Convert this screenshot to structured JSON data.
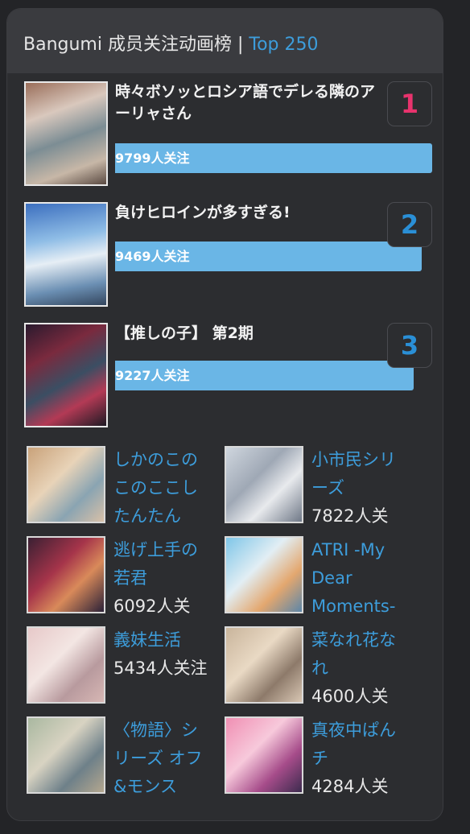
{
  "header": {
    "title": "Bangumi 成员关注动画榜 | ",
    "accent": "Top 250"
  },
  "top": [
    {
      "rank": "1",
      "title": "時々ボソッとロシア語でデレる隣のアーリャさん",
      "followers": "9799人关注",
      "share": 1.0,
      "rank_color": "#e8336d"
    },
    {
      "rank": "2",
      "title": "負けヒロインが多すぎる!",
      "followers": "9469人关注",
      "share": 0.966,
      "rank_color": "#2a8fd6"
    },
    {
      "rank": "3",
      "title": "【推しの子】 第2期",
      "followers": "9227人关注",
      "share": 0.942,
      "rank_color": "#2a8fd6"
    }
  ],
  "grid": [
    {
      "title": "しかのこのこのここしたんたん",
      "followers": ""
    },
    {
      "title": "小市民シリーズ",
      "followers": "7822人关"
    },
    {
      "title": "逃げ上手の若君",
      "followers": "6092人关"
    },
    {
      "title": "ATRI -My Dear Moments-",
      "followers": ""
    },
    {
      "title": "義妹生活",
      "followers": "5434人关注"
    },
    {
      "title": "菜なれ花なれ",
      "followers": "4600人关"
    },
    {
      "title": "〈物語〉シリーズ オフ&モンス",
      "followers": ""
    },
    {
      "title": "真夜中ぱんチ",
      "followers": "4284人关"
    }
  ]
}
